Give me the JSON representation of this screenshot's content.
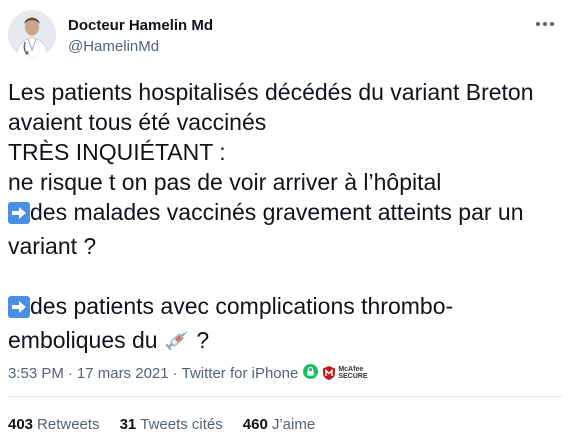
{
  "author": {
    "name": "Docteur Hamelin Md",
    "handle": "@HamelinMd"
  },
  "tweet": {
    "lines": [
      "Les patients hospitalisés décédés du variant Breton",
      "avaient tous été vaccinés",
      "TRÈS INQUIÉTANT :",
      "ne risque t on pas de voir arriver à l’hôpital",
      "des malades vaccinés gravement atteints par un",
      "variant ?",
      "des patients avec complications thrombo-",
      "emboliques du",
      "?"
    ],
    "icons": [
      "arrow-right-emoji",
      "arrow-right-emoji",
      "syringe-emoji"
    ]
  },
  "meta": {
    "time": "3:53 PM",
    "separator": "·",
    "date": "17 mars 2021",
    "source": "Twitter for iPhone",
    "mcafee_line1": "McAfee",
    "mcafee_line2": "SECURE"
  },
  "stats": {
    "retweets_count": "403",
    "retweets_label": "Retweets",
    "quotes_count": "31",
    "quotes_label": "Tweets cités",
    "likes_count": "460",
    "likes_label": "J’aime"
  },
  "colors": {
    "text": "#0f1419",
    "secondary": "#536471",
    "divider": "#dfe3e6",
    "emoji_blue": "#4a90e2",
    "secure_green": "#17bf63",
    "mcafee_red": "#c01818"
  }
}
